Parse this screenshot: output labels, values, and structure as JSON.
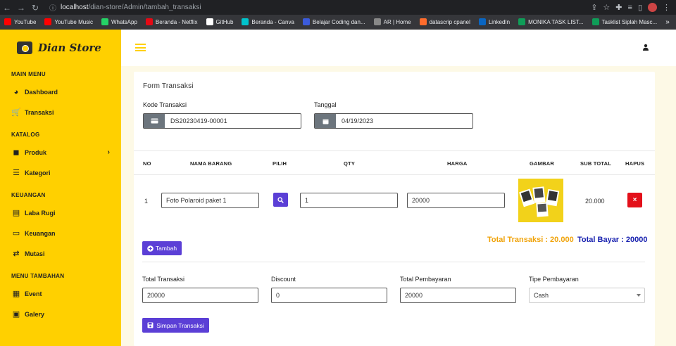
{
  "browser": {
    "url_host": "localhost",
    "url_path": "/dian-store/Admin/tambah_transaksi",
    "bookmarks": [
      {
        "label": "YouTube",
        "color": "#ff0000"
      },
      {
        "label": "YouTube Music",
        "color": "#ff0000"
      },
      {
        "label": "WhatsApp",
        "color": "#25d366"
      },
      {
        "label": "Beranda - Netflix",
        "color": "#e50914"
      },
      {
        "label": "GitHub",
        "color": "#ffffff"
      },
      {
        "label": "Beranda - Canva",
        "color": "#00c4cc"
      },
      {
        "label": "Belajar Coding dan...",
        "color": "#3b5bdb"
      },
      {
        "label": "AR | Home",
        "color": "#888888"
      },
      {
        "label": "datascrip cpanel",
        "color": "#ff6c2c"
      },
      {
        "label": "LinkedIn",
        "color": "#0a66c2"
      },
      {
        "label": "MONIKA TASK LIST...",
        "color": "#0f9d58"
      },
      {
        "label": "Tasklist Siplah Masc...",
        "color": "#0f9d58"
      }
    ],
    "bookmarks_more": "»"
  },
  "sidebar": {
    "brand": "Dian Store",
    "sections": [
      {
        "title": "MAIN MENU",
        "items": [
          {
            "label": "Dashboard",
            "icon": "palette-icon"
          },
          {
            "label": "Transaksi",
            "icon": "cart-icon"
          }
        ]
      },
      {
        "title": "KATALOG",
        "items": [
          {
            "label": "Produk",
            "icon": "box-icon",
            "chevron": "›"
          },
          {
            "label": "Kategori",
            "icon": "list-icon"
          }
        ]
      },
      {
        "title": "KEUANGAN",
        "items": [
          {
            "label": "Laba Rugi",
            "icon": "chart-icon"
          },
          {
            "label": "Keuangan",
            "icon": "money-icon"
          },
          {
            "label": "Mutasi",
            "icon": "exchange-icon"
          }
        ]
      },
      {
        "title": "MENU TAMBAHAN",
        "items": [
          {
            "label": "Event",
            "icon": "calendar-icon"
          },
          {
            "label": "Galery",
            "icon": "image-icon"
          }
        ]
      }
    ]
  },
  "form": {
    "title": "Form Transaksi",
    "kode_label": "Kode Transaksi",
    "kode_value": "DS20230419-00001",
    "tanggal_label": "Tanggal",
    "tanggal_value": "04/19/2023"
  },
  "table": {
    "headers": [
      "NO",
      "NAMA BARANG",
      "PILIH",
      "QTY",
      "HARGA",
      "GAMBAR",
      "SUB TOTAL",
      "HAPUS"
    ],
    "rows": [
      {
        "no": "1",
        "nama": "Foto Polaroid paket 1",
        "qty": "1",
        "harga": "20000",
        "subtotal": "20.000",
        "hapus": "×"
      }
    ]
  },
  "totals": {
    "total_transaksi_text": "Total Transaksi : 20.000",
    "total_bayar_text": "Total Bayar : 20000",
    "colors": {
      "transaksi": "#f0a30a",
      "bayar": "#1a23b0"
    }
  },
  "buttons": {
    "tambah": "Tambah",
    "simpan": "Simpan Transaksi"
  },
  "payment": {
    "total_label": "Total Transaksi",
    "total_value": "20000",
    "discount_label": "Discount",
    "discount_value": "0",
    "pembayaran_label": "Total Pembayaran",
    "pembayaran_value": "20000",
    "tipe_label": "Tipe Pembayaran",
    "tipe_value": "Cash"
  },
  "theme": {
    "accent": "#ffd000",
    "primary_btn": "#5b3fd6",
    "danger": "#e3101a"
  }
}
